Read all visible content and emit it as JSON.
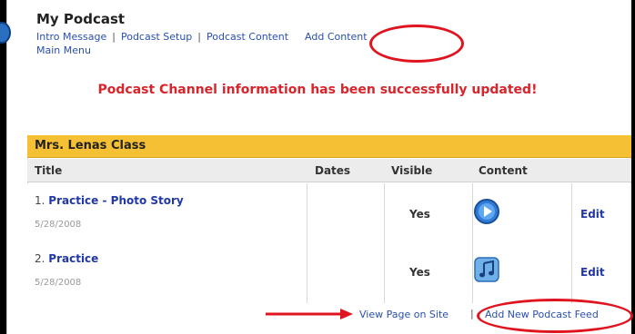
{
  "page": {
    "title": "My Podcast",
    "nav": [
      "Intro Message",
      "Podcast Setup",
      "Podcast Content",
      "Add Content"
    ],
    "main_menu": "Main Menu",
    "success_message": "Podcast Channel information has been successfully updated!"
  },
  "table": {
    "class_name": "Mrs. Lenas Class",
    "columns": [
      "Title",
      "Dates",
      "Visible",
      "Content"
    ],
    "rows": [
      {
        "num": "1.",
        "title": "Practice - Photo Story",
        "date": "5/28/2008",
        "visible": "Yes",
        "content_icon": "media-player-icon",
        "action": "Edit"
      },
      {
        "num": "2.",
        "title": "Practice",
        "date": "5/28/2008",
        "visible": "Yes",
        "content_icon": "music-note-icon",
        "action": "Edit"
      }
    ]
  },
  "footer": {
    "view_page": "View Page on Site",
    "separator": "|",
    "add_feed": "Add New Podcast Feed"
  },
  "annotations": {
    "highlight_color": "#e0141e"
  }
}
